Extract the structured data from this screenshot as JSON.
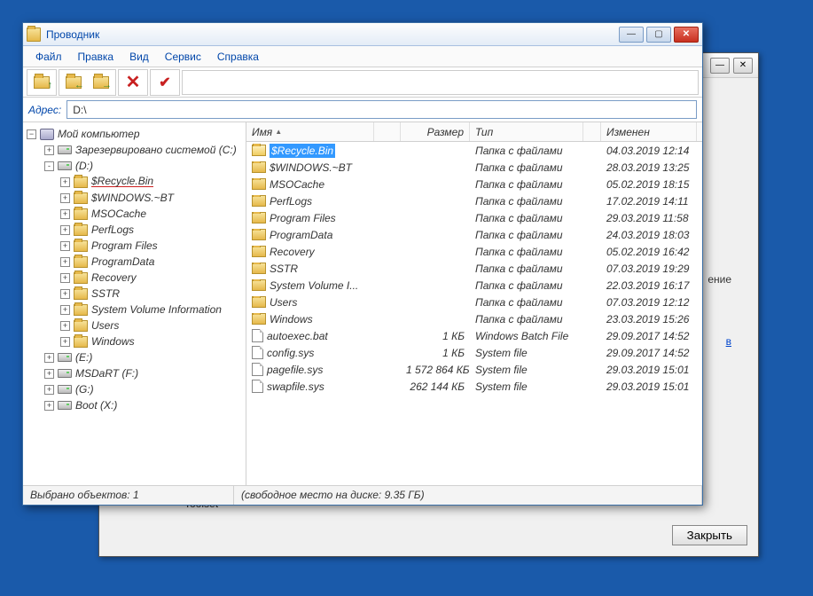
{
  "bg_window": {
    "stub_text": "ение",
    "stub_link": "в",
    "close_label": "Закрыть",
    "toolset_label": "Toolset"
  },
  "window": {
    "title": "Проводник"
  },
  "menu": {
    "file": "Файл",
    "edit": "Правка",
    "view": "Вид",
    "service": "Сервис",
    "help": "Справка"
  },
  "toolbar": {
    "btn_up": "folder-up",
    "btn_back": "folder-back",
    "btn_fwd": "folder-forward",
    "btn_delete": "delete",
    "btn_check": "check"
  },
  "address": {
    "label": "Адрес:",
    "value": "D:\\"
  },
  "tree": {
    "root": "Мой компьютер",
    "nodes": [
      {
        "label": "Зарезервировано системой (C:)",
        "icon": "drive",
        "exp": "+",
        "depth": 1
      },
      {
        "label": "(D:)",
        "icon": "drive",
        "exp": "-",
        "depth": 1
      },
      {
        "label": "$Recycle.Bin",
        "icon": "folder",
        "exp": "+",
        "depth": 2,
        "red": true
      },
      {
        "label": "$WINDOWS.~BT",
        "icon": "folder",
        "exp": "+",
        "depth": 2
      },
      {
        "label": "MSOCache",
        "icon": "folder",
        "exp": "+",
        "depth": 2
      },
      {
        "label": "PerfLogs",
        "icon": "folder",
        "exp": "+",
        "depth": 2
      },
      {
        "label": "Program Files",
        "icon": "folder",
        "exp": "+",
        "depth": 2
      },
      {
        "label": "ProgramData",
        "icon": "folder",
        "exp": "+",
        "depth": 2
      },
      {
        "label": "Recovery",
        "icon": "folder",
        "exp": "+",
        "depth": 2
      },
      {
        "label": "SSTR",
        "icon": "folder",
        "exp": "+",
        "depth": 2
      },
      {
        "label": "System Volume Information",
        "icon": "folder",
        "exp": "+",
        "depth": 2
      },
      {
        "label": "Users",
        "icon": "folder",
        "exp": "+",
        "depth": 2
      },
      {
        "label": "Windows",
        "icon": "folder",
        "exp": "+",
        "depth": 2
      },
      {
        "label": "(E:)",
        "icon": "drive",
        "exp": "+",
        "depth": 1
      },
      {
        "label": "MSDaRT (F:)",
        "icon": "drive",
        "exp": "+",
        "depth": 1
      },
      {
        "label": "(G:)",
        "icon": "drive",
        "exp": "+",
        "depth": 1
      },
      {
        "label": "Boot (X:)",
        "icon": "drive",
        "exp": "+",
        "depth": 1
      }
    ]
  },
  "list": {
    "headers": {
      "name": "Имя",
      "size": "Размер",
      "type": "Тип",
      "modified": "Изменен"
    },
    "rows": [
      {
        "name": "$Recycle.Bin",
        "size": "",
        "type": "Папка с файлами",
        "mod": "04.03.2019 12:14",
        "icon": "folder-open",
        "selected": true
      },
      {
        "name": "$WINDOWS.~BT",
        "size": "",
        "type": "Папка с файлами",
        "mod": "28.03.2019 13:25",
        "icon": "folder"
      },
      {
        "name": "MSOCache",
        "size": "",
        "type": "Папка с файлами",
        "mod": "05.02.2019 18:15",
        "icon": "folder"
      },
      {
        "name": "PerfLogs",
        "size": "",
        "type": "Папка с файлами",
        "mod": "17.02.2019 14:11",
        "icon": "folder"
      },
      {
        "name": "Program Files",
        "size": "",
        "type": "Папка с файлами",
        "mod": "29.03.2019 11:58",
        "icon": "folder"
      },
      {
        "name": "ProgramData",
        "size": "",
        "type": "Папка с файлами",
        "mod": "24.03.2019 18:03",
        "icon": "folder"
      },
      {
        "name": "Recovery",
        "size": "",
        "type": "Папка с файлами",
        "mod": "05.02.2019 16:42",
        "icon": "folder"
      },
      {
        "name": "SSTR",
        "size": "",
        "type": "Папка с файлами",
        "mod": "07.03.2019 19:29",
        "icon": "folder"
      },
      {
        "name": "System Volume I...",
        "size": "",
        "type": "Папка с файлами",
        "mod": "22.03.2019 16:17",
        "icon": "folder"
      },
      {
        "name": "Users",
        "size": "",
        "type": "Папка с файлами",
        "mod": "07.03.2019 12:12",
        "icon": "folder"
      },
      {
        "name": "Windows",
        "size": "",
        "type": "Папка с файлами",
        "mod": "23.03.2019 15:26",
        "icon": "folder"
      },
      {
        "name": "autoexec.bat",
        "size": "1 КБ",
        "type": "Windows Batch File",
        "mod": "29.09.2017 14:52",
        "icon": "file"
      },
      {
        "name": "config.sys",
        "size": "1 КБ",
        "type": "System file",
        "mod": "29.09.2017 14:52",
        "icon": "file"
      },
      {
        "name": "pagefile.sys",
        "size": "1 572 864 КБ",
        "type": "System file",
        "mod": "29.03.2019 15:01",
        "icon": "file"
      },
      {
        "name": "swapfile.sys",
        "size": "262 144 КБ",
        "type": "System file",
        "mod": "29.03.2019 15:01",
        "icon": "file"
      }
    ]
  },
  "status": {
    "selected": "Выбрано объектов: 1",
    "free": "(свободное место на диске: 9.35 ГБ)"
  }
}
